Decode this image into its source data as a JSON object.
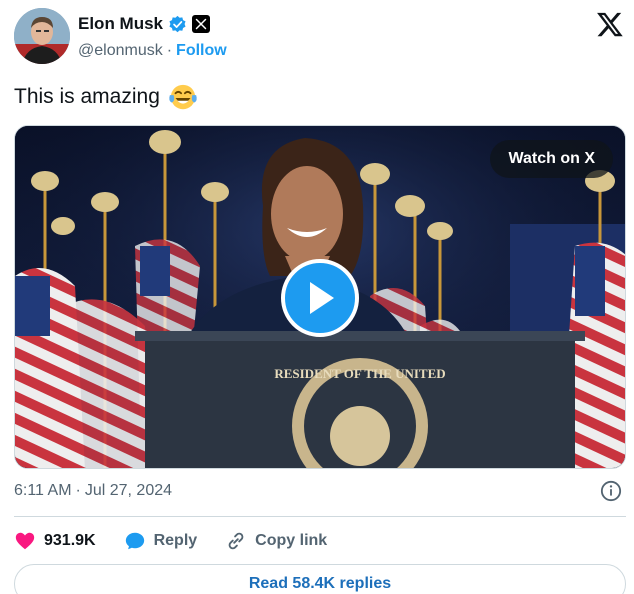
{
  "author": {
    "display_name": "Elon Musk",
    "handle": "@elonmusk",
    "separator": "·",
    "follow_label": "Follow",
    "verified_icon": "verified-badge-icon",
    "affiliate_icon": "x-affiliate-icon",
    "avatar_icon": "avatar"
  },
  "brand": {
    "logo_icon": "x-logo-icon"
  },
  "tweet": {
    "text": "This is amazing",
    "emoji_icon": "tears-of-joy-emoji"
  },
  "media": {
    "watch_label": "Watch on X",
    "play_icon": "play-icon",
    "seal_text": "RESIDENT OF THE UNITED"
  },
  "meta": {
    "time": "6:11 AM",
    "separator": "·",
    "date": "Jul 27, 2024",
    "info_icon": "info-icon"
  },
  "actions": {
    "likes_count": "931.9K",
    "reply_label": "Reply",
    "copy_link_label": "Copy link"
  },
  "footer": {
    "read_replies_label": "Read 58.4K replies"
  },
  "colors": {
    "accent": "#1d9bf0",
    "like": "#f91880",
    "text_primary": "#0f1419",
    "text_secondary": "#536471",
    "border": "#cfd9de"
  }
}
